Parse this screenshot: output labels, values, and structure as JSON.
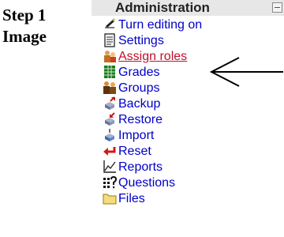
{
  "caption": {
    "line1": "Step 1",
    "line2": "Image"
  },
  "block": {
    "title": "Administration",
    "items": [
      {
        "label": "Turn editing on",
        "icon": "edit-icon"
      },
      {
        "label": "Settings",
        "icon": "settings-icon"
      },
      {
        "label": "Assign roles",
        "icon": "roles-icon",
        "highlighted": true
      },
      {
        "label": "Grades",
        "icon": "grades-icon"
      },
      {
        "label": "Groups",
        "icon": "groups-icon"
      },
      {
        "label": "Backup",
        "icon": "backup-icon"
      },
      {
        "label": "Restore",
        "icon": "restore-icon"
      },
      {
        "label": "Import",
        "icon": "import-icon"
      },
      {
        "label": "Reset",
        "icon": "reset-icon"
      },
      {
        "label": "Reports",
        "icon": "reports-icon"
      },
      {
        "label": "Questions",
        "icon": "questions-icon"
      },
      {
        "label": "Files",
        "icon": "files-icon"
      }
    ]
  },
  "colors": {
    "link": "#0000c8",
    "active_link": "#c0102b",
    "header_bg": "#e7e7e7"
  }
}
